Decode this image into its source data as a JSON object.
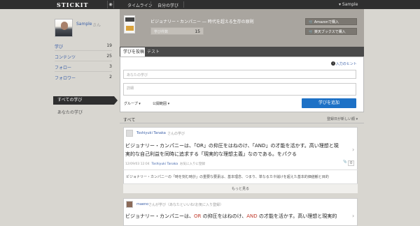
{
  "header": {
    "logo": "STICKIT",
    "nav_timeline": "タイムライン",
    "nav_mine": "自分の学び",
    "user_menu": "▾ Sample"
  },
  "profile": {
    "name": "Sample",
    "name_suffix": "さん",
    "stats": [
      {
        "label": "学び",
        "value": "19"
      },
      {
        "label": "コンテンツ",
        "value": "25"
      },
      {
        "label": "フォロー",
        "value": "3"
      },
      {
        "label": "フォロワー",
        "value": "2"
      }
    ]
  },
  "sidebar": {
    "all_learnings": "すべての学び",
    "your_learnings": "あなたの学び"
  },
  "book": {
    "title": "ビジョナリー・カンパニー ― 時代を超える生存の原則",
    "count_label": "学び件数",
    "count_value": "15",
    "buy_amazon": "Amazonで購入",
    "buy_rakuten": "楽天ブックスで購入"
  },
  "tabs": {
    "post": "学びを投稿",
    "test": "テスト"
  },
  "form": {
    "hint": "入力のヒント",
    "learning_placeholder": "あなたの学び",
    "detail_placeholder": "詳細",
    "group": "グループ ▾",
    "scope": "公開範囲 ▾",
    "submit": "学びを追加"
  },
  "feed": {
    "filter": "すべて",
    "sort": "登録日が新しい順 ▾",
    "cards": [
      {
        "user": "Toshiyuki Tanaka",
        "user_suffix": "さんの学び",
        "text_line1": "ビジョナリー・カンパニーは、「OR」の抑圧をはねのけ、「AND」の才能を活かす。高い理想と現",
        "text_line2": "実的な自己利益を同時に追求する「現実的な理想主義」なのである。をパクる",
        "meta_date": "12/09/03 12:04",
        "meta_user": "Toshiyuki Tanaka",
        "meta_rest": "お気に入りに登録",
        "count": "0",
        "desc": "ビジョナリー・カンパニーの「時を刻む時計」の重要な要素は、基本理念、つまり、単なるカネ儲けを超えた基本的価値観と目的",
        "more": "もっと見る"
      },
      {
        "user": "maeno",
        "user_suffix": "さんが学び（あなたといいね!お気に入り登録）",
        "text_pre": "ビジョナリー・カンパニーは、",
        "text_or": "OR",
        "text_mid": " の抑圧をはねのけ、",
        "text_and": "AND",
        "text_post": " の才能を活かす。高い理想と現実的"
      }
    ]
  }
}
